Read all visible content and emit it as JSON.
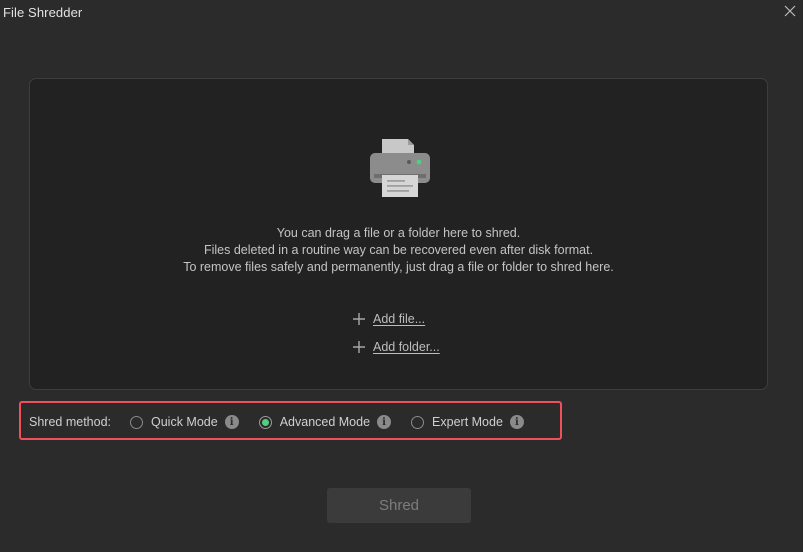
{
  "window": {
    "title": "File Shredder"
  },
  "dropzone": {
    "messages": [
      "You can drag a file or a folder here to shred.",
      "Files deleted in a routine way can be recovered even after disk format.",
      "To remove files safely and permanently, just drag a file or folder to shred here."
    ],
    "add_file_label": "Add file...",
    "add_folder_label": "Add folder...",
    "icon": "printer-icon"
  },
  "shred_method": {
    "label": "Shred method:",
    "options": [
      {
        "label": "Quick Mode",
        "selected": false
      },
      {
        "label": "Advanced Mode",
        "selected": true
      },
      {
        "label": "Expert Mode",
        "selected": false
      }
    ],
    "highlight_color": "#f0505c",
    "selected_color": "#4fd07a"
  },
  "actions": {
    "shred_label": "Shred",
    "shred_enabled": false
  }
}
